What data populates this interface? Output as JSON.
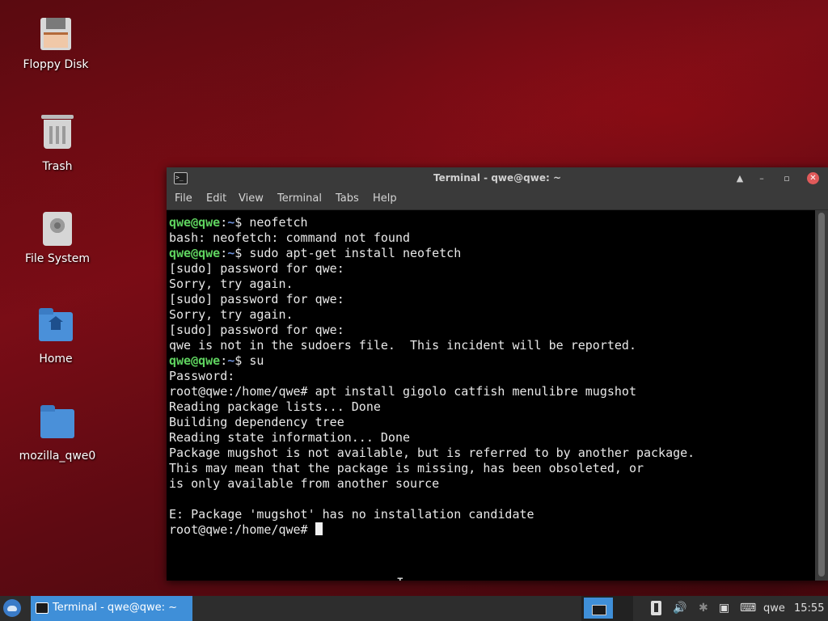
{
  "desktop": {
    "icons": [
      {
        "label": "Floppy Disk",
        "icon": "floppy-disk-icon"
      },
      {
        "label": "Trash",
        "icon": "trash-icon"
      },
      {
        "label": "File System",
        "icon": "drive-icon"
      },
      {
        "label": "Home",
        "icon": "home-folder-icon"
      },
      {
        "label": "mozilla_qwe0",
        "icon": "folder-icon"
      }
    ]
  },
  "terminal": {
    "title": "Terminal - qwe@qwe: ~",
    "app_icon": ">_",
    "controls": {
      "shade": "▲",
      "minimize": "–",
      "maximize": "▫",
      "close": "✕"
    },
    "menu": [
      "File",
      "Edit",
      "View",
      "Terminal",
      "Tabs",
      "Help"
    ],
    "lines": [
      {
        "user": "qwe@qwe",
        "sep": ":",
        "path": "~",
        "rest": "$ neofetch"
      },
      {
        "text": "bash: neofetch: command not found"
      },
      {
        "user": "qwe@qwe",
        "sep": ":",
        "path": "~",
        "rest": "$ sudo apt-get install neofetch"
      },
      {
        "text": "[sudo] password for qwe:"
      },
      {
        "text": "Sorry, try again."
      },
      {
        "text": "[sudo] password for qwe:"
      },
      {
        "text": "Sorry, try again."
      },
      {
        "text": "[sudo] password for qwe:"
      },
      {
        "text": "qwe is not in the sudoers file.  This incident will be reported."
      },
      {
        "user": "qwe@qwe",
        "sep": ":",
        "path": "~",
        "rest": "$ su"
      },
      {
        "text": "Password:"
      },
      {
        "text": "root@qwe:/home/qwe# apt install gigolo catfish menulibre mugshot"
      },
      {
        "text": "Reading package lists... Done"
      },
      {
        "text": "Building dependency tree"
      },
      {
        "text": "Reading state information... Done"
      },
      {
        "text": "Package mugshot is not available, but is referred to by another package."
      },
      {
        "text": "This may mean that the package is missing, has been obsoleted, or"
      },
      {
        "text": "is only available from another source"
      },
      {
        "text": ""
      },
      {
        "text": "E: Package 'mugshot' has no installation candidate"
      },
      {
        "text": "root@qwe:/home/qwe# "
      }
    ],
    "mouse_cursor": "I",
    "colors": {
      "prompt_user": "#5fd35f",
      "prompt_path": "#6c8fd8",
      "background": "#000000"
    }
  },
  "panel": {
    "task_label": "Terminal - qwe@qwe: ~",
    "tray": {
      "volume": "🔊",
      "bluetooth": "✱",
      "network": "▣",
      "keyboard": "⌨",
      "user": "qwe",
      "clock": "15:55"
    }
  }
}
